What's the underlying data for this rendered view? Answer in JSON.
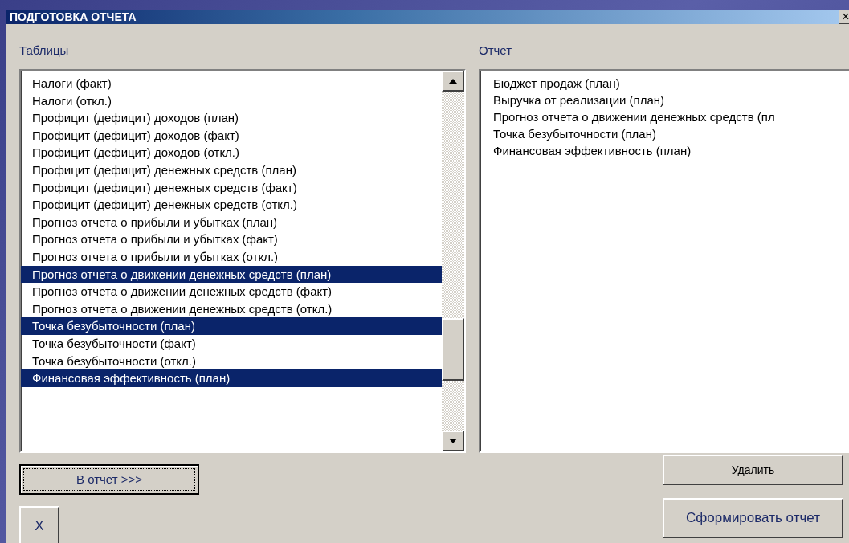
{
  "window": {
    "title": "ПОДГОТОВКА ОТЧЕТА",
    "close": "×"
  },
  "tables": {
    "label": "Таблицы",
    "items": [
      {
        "text": "Налоги (факт)",
        "selected": false
      },
      {
        "text": "Налоги (откл.)",
        "selected": false
      },
      {
        "text": "Профицит (дефицит) доходов (план)",
        "selected": false
      },
      {
        "text": "Профицит (дефицит) доходов (факт)",
        "selected": false
      },
      {
        "text": "Профицит (дефицит) доходов (откл.)",
        "selected": false
      },
      {
        "text": "Профицит (дефицит) денежных средств (план)",
        "selected": false
      },
      {
        "text": "Профицит (дефицит) денежных средств (факт)",
        "selected": false
      },
      {
        "text": "Профицит (дефицит) денежных средств (откл.)",
        "selected": false
      },
      {
        "text": "Прогноз отчета о прибыли и убытках (план)",
        "selected": false
      },
      {
        "text": "Прогноз отчета о прибыли и убытках (факт)",
        "selected": false
      },
      {
        "text": "Прогноз отчета о прибыли и убытках (откл.)",
        "selected": false
      },
      {
        "text": "Прогноз отчета о движении денежных средств (план)",
        "selected": true
      },
      {
        "text": "Прогноз отчета о движении денежных средств (факт)",
        "selected": false
      },
      {
        "text": "Прогноз отчета о движении денежных средств (откл.)",
        "selected": false
      },
      {
        "text": "Точка безубыточности (план)",
        "selected": true
      },
      {
        "text": "Точка безубыточности (факт)",
        "selected": false
      },
      {
        "text": "Точка безубыточности (откл.)",
        "selected": false
      },
      {
        "text": "Финансовая эффективность (план)",
        "selected": true
      }
    ]
  },
  "report": {
    "label": "Отчет",
    "items": [
      "Бюджет продаж (план)",
      "Выручка от реализации (план)",
      "Прогноз отчета о движении денежных средств (пл",
      "Точка безубыточности (план)",
      "Финансовая эффективность (план)"
    ]
  },
  "buttons": {
    "add": "В отчет >>>",
    "close": "X",
    "delete": "Удалить",
    "build": "Сформировать отчет"
  }
}
